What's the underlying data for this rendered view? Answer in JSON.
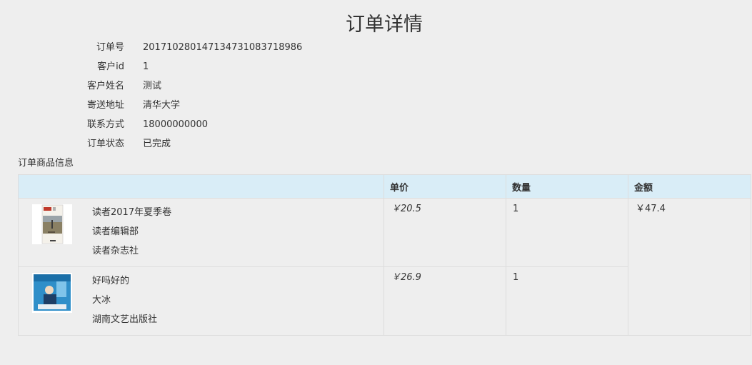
{
  "page": {
    "title": "订单详情"
  },
  "order": {
    "fields": [
      {
        "label": "订单号",
        "value": "20171028014713473108371898​6"
      },
      {
        "label": "客户id",
        "value": "1"
      },
      {
        "label": "客户姓名",
        "value": "测试"
      },
      {
        "label": "寄送地址",
        "value": "清华大学"
      },
      {
        "label": "联系方式",
        "value": "18000000000"
      },
      {
        "label": "订单状态",
        "value": "已完成"
      }
    ]
  },
  "items_section": {
    "label": "订单商品信息",
    "columns": [
      "",
      "单价",
      "数量",
      "金额"
    ],
    "items": [
      {
        "title": "读者2017年夏季卷",
        "author": "读者编辑部",
        "publisher": "读者杂志社",
        "price": "￥20.5",
        "quantity": "1",
        "cover_icon": "book-cover-icon"
      },
      {
        "title": "好吗好的",
        "author": "大冰",
        "publisher": "湖南文艺出版社",
        "price": "￥26.9",
        "quantity": "1",
        "cover_icon": "book-cover-icon"
      }
    ],
    "total": "￥47.4"
  }
}
